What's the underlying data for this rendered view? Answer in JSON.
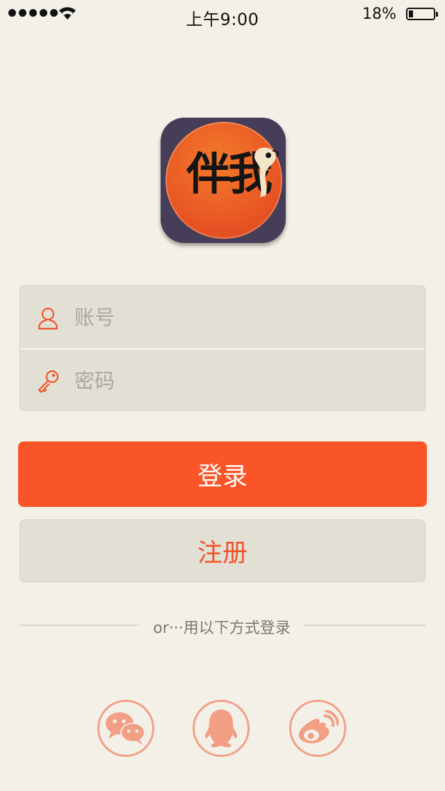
{
  "status_bar": {
    "time": "上午9:00",
    "battery_percent": "18%",
    "battery_level": 0.18,
    "signal_bars": 5
  },
  "app": {
    "logo_text": "伴我",
    "icon_bg_color": "#463e58",
    "icon_circle_color": "#ea5a25"
  },
  "form": {
    "account_placeholder": "账号",
    "account_value": "",
    "password_placeholder": "密码",
    "password_value": ""
  },
  "buttons": {
    "login_label": "登录",
    "register_label": "注册"
  },
  "divider": {
    "text": "or···用以下方式登录"
  },
  "social": [
    {
      "name": "wechat-icon"
    },
    {
      "name": "qq-icon"
    },
    {
      "name": "weibo-icon"
    }
  ],
  "colors": {
    "accent": "#fa5528",
    "background": "#f3f1e7",
    "field_bg": "#e2e0d5",
    "social_icon": "#f29f86"
  }
}
